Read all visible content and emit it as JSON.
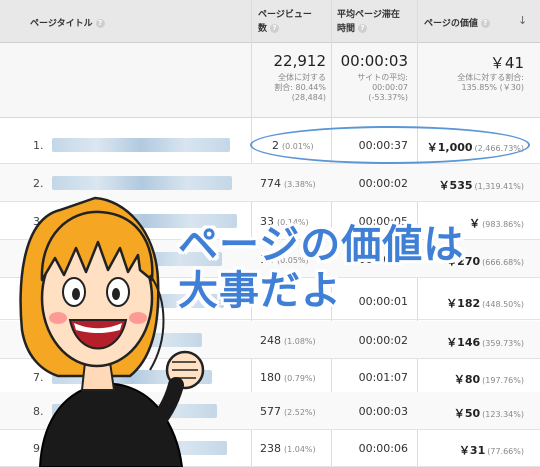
{
  "header": {
    "page_title_col": "ページタイトル",
    "pageviews_col_line1": "ページビュー",
    "pageviews_col_line2": "数",
    "avg_time_col_line1": "平均ページ滞在",
    "avg_time_col_line2": "時間",
    "page_value_col": "ページの価値",
    "help_glyph": "?",
    "sort_glyph": "↓"
  },
  "totals": {
    "pageviews": "22,912",
    "pageviews_sub1": "全体に対する",
    "pageviews_sub2": "割合: 80.44%",
    "pageviews_sub3": "(28,484)",
    "avg_time": "00:00:03",
    "avg_time_sub1": "サイトの平均:",
    "avg_time_sub2": "00:00:07",
    "avg_time_sub3": "(-53.37%)",
    "page_value": "￥41",
    "page_value_sub1": "全体に対する割合:",
    "page_value_sub2": "135.85% (￥30)"
  },
  "rows": [
    {
      "num": "1.",
      "views": "2",
      "views_pct": "(0.01%)",
      "time": "00:00:37",
      "value": "￥1,000",
      "value_pct": "(2,466.73%)"
    },
    {
      "num": "2.",
      "views": "774",
      "views_pct": "(3.38%)",
      "time": "00:00:02",
      "value": "￥535",
      "value_pct": "(1,319.41%)"
    },
    {
      "num": "3.",
      "views": "33",
      "views_pct": "(0.14%)",
      "time": "00:00:05",
      "value": "￥",
      "value_pct": "(983.86%)"
    },
    {
      "num": "4.",
      "views": "12",
      "views_pct": "(0.05%)",
      "time": "00:00:08",
      "value": "￥270",
      "value_pct": "(666.68%)"
    },
    {
      "num": "5.",
      "views": "",
      "views_pct": "",
      "time": "00:00:01",
      "value": "￥182",
      "value_pct": "(448.50%)"
    },
    {
      "num": "6.",
      "views": "248",
      "views_pct": "(1.08%)",
      "time": "00:00:02",
      "value": "￥146",
      "value_pct": "(359.73%)"
    },
    {
      "num": "7.",
      "views": "180",
      "views_pct": "(0.79%)",
      "time": "00:01:07",
      "value": "￥80",
      "value_pct": "(197.76%)"
    },
    {
      "num": "8.",
      "views": "577",
      "views_pct": "(2.52%)",
      "time": "00:00:03",
      "value": "￥50",
      "value_pct": "(123.34%)"
    },
    {
      "num": "9.",
      "views": "238",
      "views_pct": "(1.04%)",
      "time": "00:00:06",
      "value": "￥31",
      "value_pct": "(77.66%)"
    }
  ],
  "overlay": {
    "line1": "ページの価値は",
    "line2": "大事だよ"
  }
}
